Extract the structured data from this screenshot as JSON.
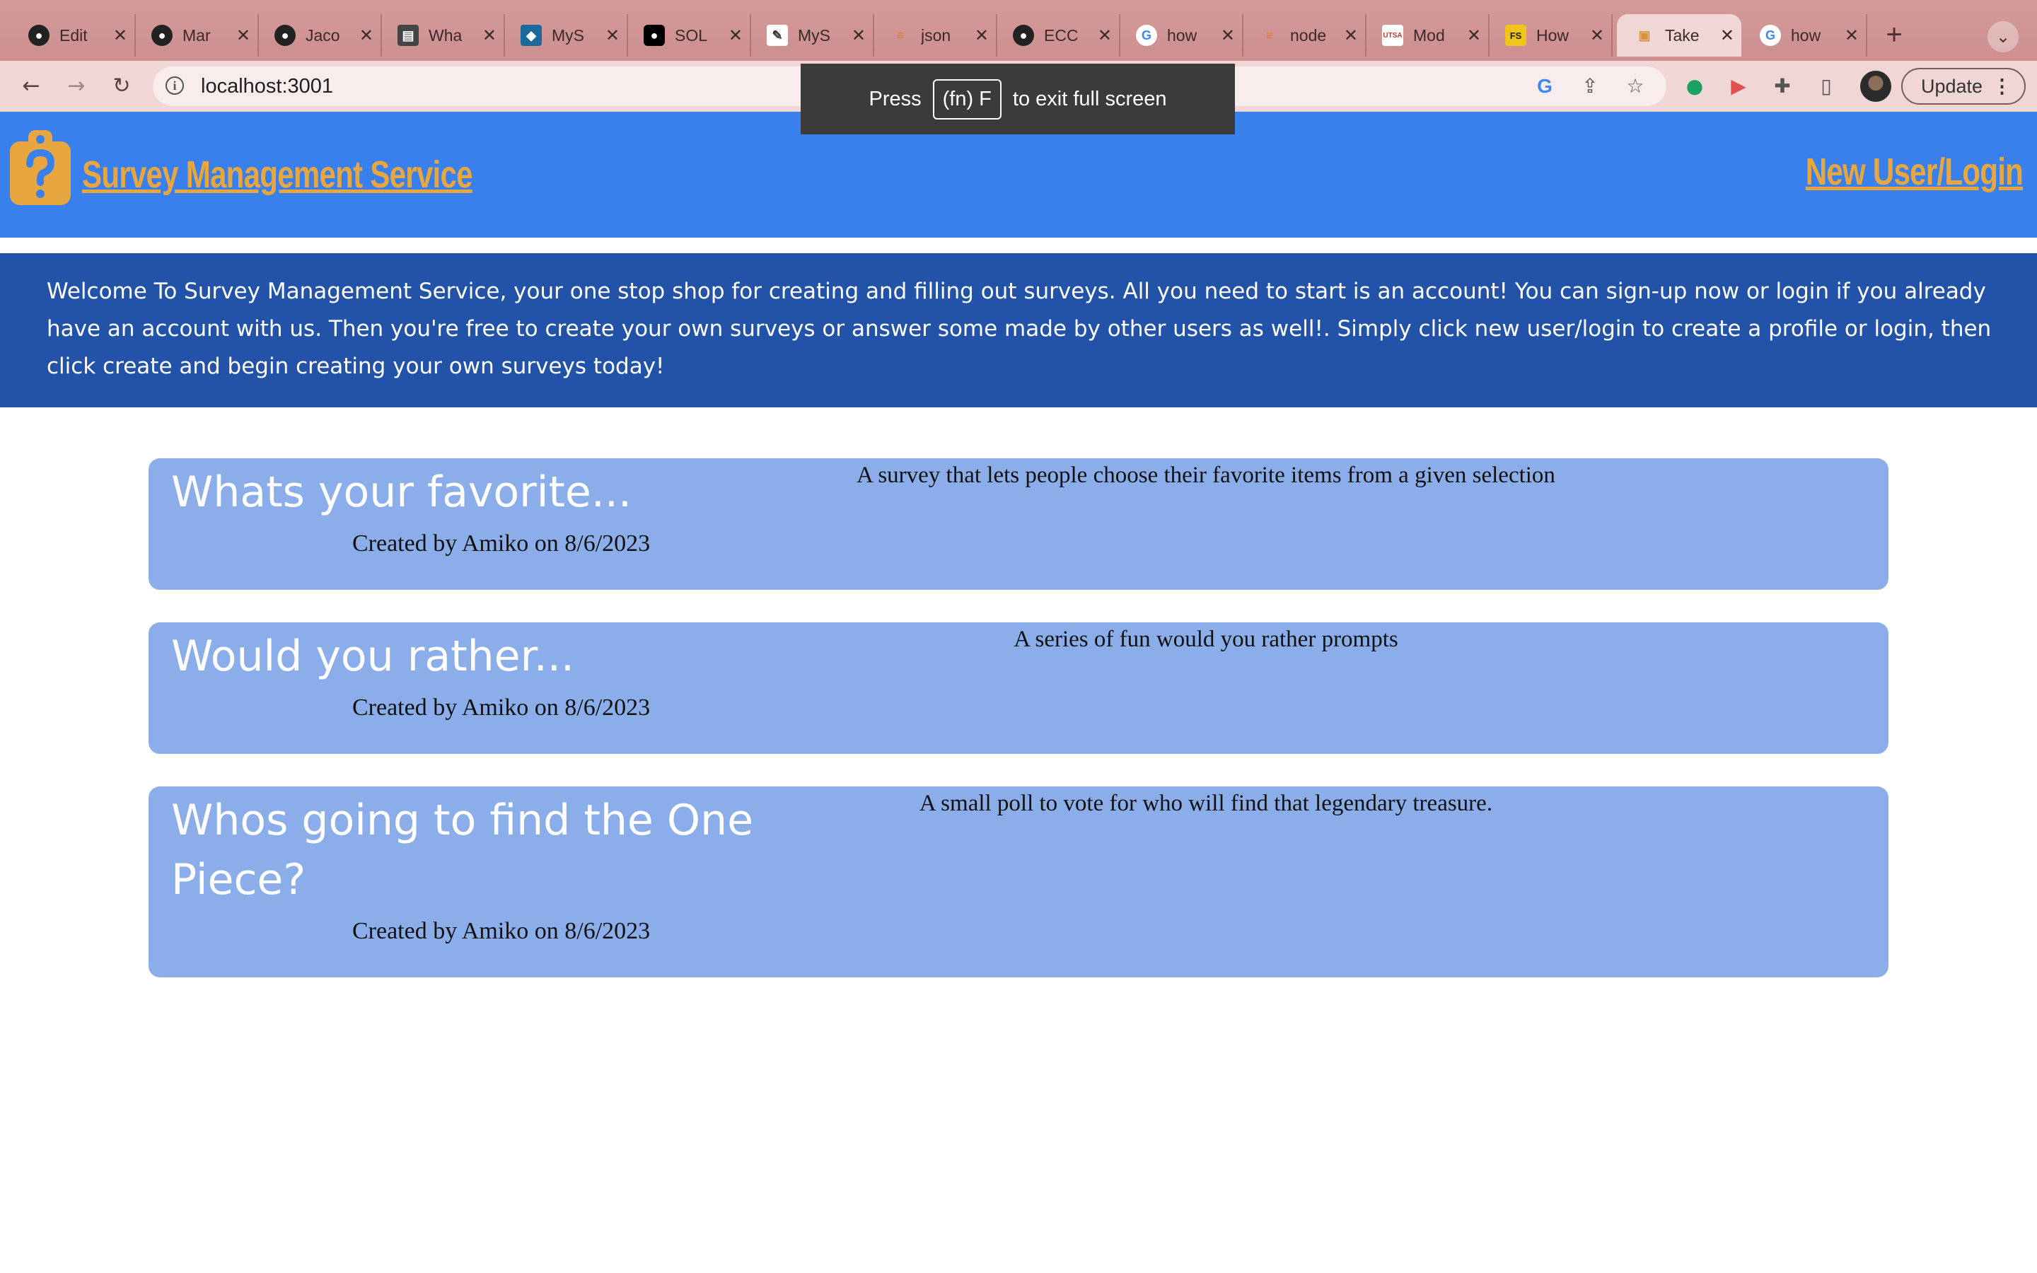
{
  "browser": {
    "tabs": [
      {
        "title": "Edit",
        "icon": "github-icon"
      },
      {
        "title": "Mar",
        "icon": "github-icon"
      },
      {
        "title": "Jaco",
        "icon": "github-icon"
      },
      {
        "title": "Wha",
        "icon": "id-card-icon"
      },
      {
        "title": "MyS",
        "icon": "mysql-icon"
      },
      {
        "title": "SOL",
        "icon": "medium-icon"
      },
      {
        "title": "MyS",
        "icon": "stamp-icon"
      },
      {
        "title": "json",
        "icon": "stackoverflow-icon"
      },
      {
        "title": "ECC",
        "icon": "github-icon"
      },
      {
        "title": "how",
        "icon": "google-icon"
      },
      {
        "title": "node",
        "icon": "stackoverflow-icon"
      },
      {
        "title": "Mod",
        "icon": "utsa-icon"
      },
      {
        "title": "How",
        "icon": "fs-icon"
      },
      {
        "title": "Take",
        "icon": "clipboard-icon",
        "active": true
      },
      {
        "title": "how",
        "icon": "google-icon"
      }
    ],
    "url": "localhost:3001",
    "update_label": "Update",
    "fullscreen_toast": {
      "press": "Press",
      "key": "(fn) F",
      "rest": "to exit full screen"
    }
  },
  "site": {
    "title": "Survey Management Service",
    "login_link": "New User/Login",
    "welcome": "Welcome To Survey Management Service, your one stop shop for creating and filling out surveys. All you need to start is an account! You can sign-up now or login if you already have an account with us. Then you're free to create your own surveys or answer some made by other users as well!. Simply click new user/login to create a profile or login, then click create and begin creating your own surveys today!"
  },
  "surveys": [
    {
      "title": "Whats your favorite...",
      "meta": "Created by Amiko on 8/6/2023",
      "description": "A survey that lets people choose their favorite items from a given selection"
    },
    {
      "title": "Would you rather...",
      "meta": "Created by Amiko on 8/6/2023",
      "description": "A series of fun would you rather prompts"
    },
    {
      "title": "Whos going to find the One Piece?",
      "meta": "Created by Amiko on 8/6/2023",
      "description": "A small poll to vote for who will find that legendary treasure."
    }
  ],
  "colors": {
    "header": "#3a80ec",
    "welcome_band": "#2353a8",
    "card": "#8badea",
    "accent": "#e8a63e",
    "tabstrip": "#d49a9a"
  }
}
